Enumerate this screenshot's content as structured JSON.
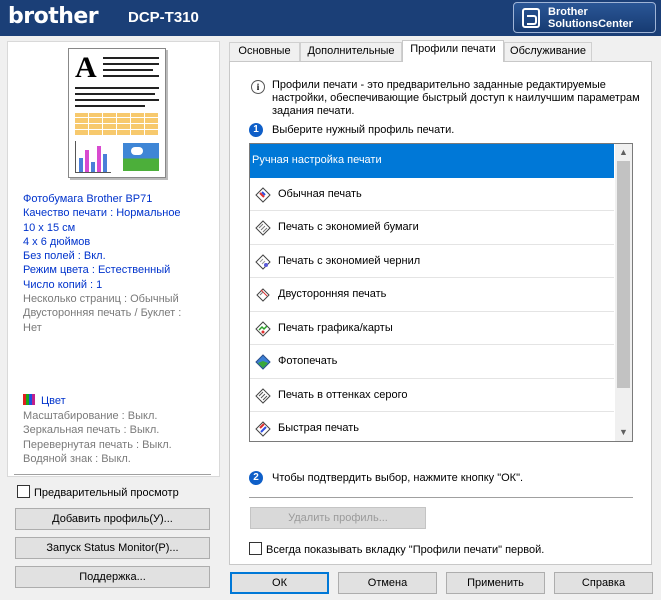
{
  "header": {
    "logo": "brother",
    "model": "DCP-T310",
    "solutions_center_line1": "Brother",
    "solutions_center_line2": "SolutionsCenter"
  },
  "tabs": [
    "Основные",
    "Дополнительные",
    "Профили печати",
    "Обслуживание"
  ],
  "active_tab": "Профили печати",
  "settings_summary": {
    "lines_blue": [
      "Фотобумага Brother BP71",
      "Качество печати : Нормальное",
      "10 x 15 см",
      "4 x 6 дюймов",
      "Без полей : Вкл.",
      "Режим цвета : Естественный",
      "Число копий : 1"
    ],
    "lines_gray": [
      "Несколько страниц : Обычный",
      "Двусторонняя печать / Буклет :",
      "Нет"
    ],
    "color_label": "Цвет",
    "lines_gray2": [
      "Масштабирование : Выкл.",
      "Зеркальная печать : Выкл.",
      "Перевернутая печать : Выкл.",
      "Водяной знак : Выкл."
    ]
  },
  "left": {
    "preview_checkbox": "Предварительный просмотр",
    "add_profile_button": "Добавить профиль(У)...",
    "status_monitor_button": "Запуск Status Monitor(P)...",
    "support_button": "Поддержка..."
  },
  "profiles_tab": {
    "info_icon": "i",
    "description": "Профили печати - это предварительно заданные редактируемые настройки, обеспечивающие быстрый доступ к наилучшим параметрам задания печати.",
    "step1_num": "1",
    "step1_text": "Выберите нужный профиль печати.",
    "profiles": [
      {
        "label": "Ручная настройка печати",
        "icon": "none",
        "selected": true
      },
      {
        "label": "Обычная печать",
        "icon": "document-color-icon"
      },
      {
        "label": "Печать с экономией бумаги",
        "icon": "document-gray-icon"
      },
      {
        "label": "Печать с экономией чернил",
        "icon": "document-ink-icon"
      },
      {
        "label": "Двусторонняя печать",
        "icon": "duplex-icon"
      },
      {
        "label": "Печать графика/карты",
        "icon": "graph-map-icon"
      },
      {
        "label": "Фотопечать",
        "icon": "photo-icon"
      },
      {
        "label": "Печать в оттенках серого",
        "icon": "grayscale-icon"
      },
      {
        "label": "Быстрая печать",
        "icon": "fast-print-icon"
      }
    ],
    "step2_num": "2",
    "step2_text": "Чтобы подтвердить выбор, нажмите кнопку \"ОК\".",
    "delete_profile_button": "Удалить профиль...",
    "always_show_checkbox": "Всегда показывать вкладку \"Профили печати\" первой."
  },
  "footer": {
    "ok": "ОК",
    "cancel": "Отмена",
    "apply": "Применить",
    "help": "Справка"
  },
  "colors": {
    "header_bg": "#1b3f77",
    "selection": "#0078d7",
    "summary_blue": "#0033cc"
  }
}
